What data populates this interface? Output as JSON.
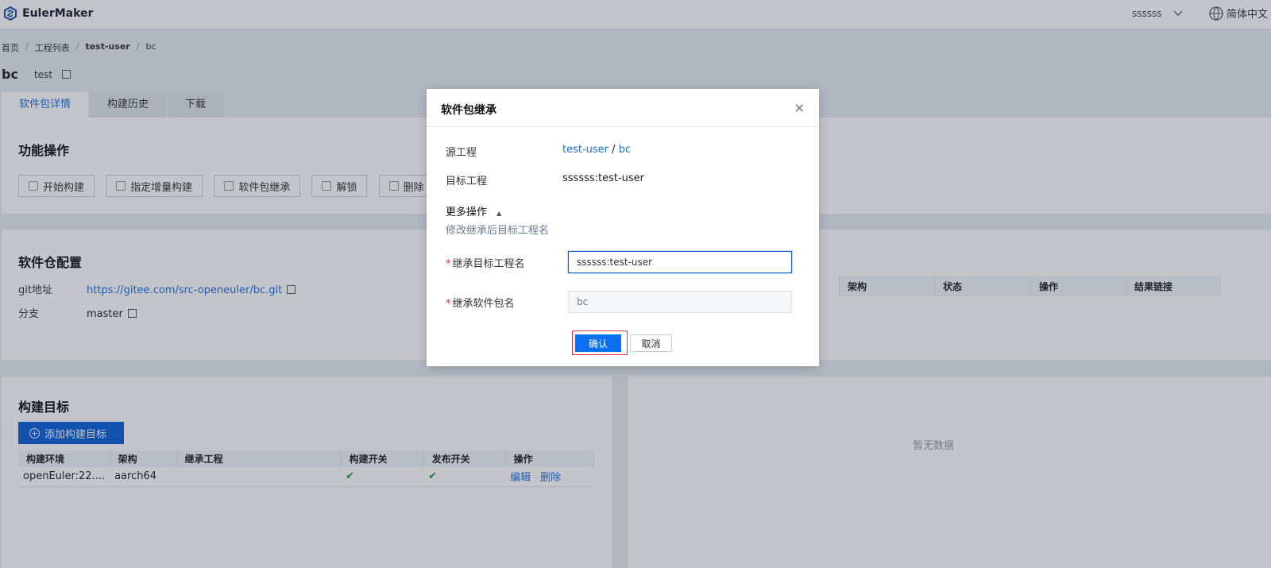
{
  "app": {
    "name": "EulerMaker",
    "user": "ssssss",
    "language": "简体中文"
  },
  "breadcrumb": [
    "首页",
    "工程列表",
    "test-user",
    "bc"
  ],
  "package": {
    "name": "bc",
    "description": "test"
  },
  "tabs": [
    "软件包详情",
    "构建历史",
    "下载"
  ],
  "ops": {
    "title": "功能操作",
    "buttons": [
      "开始构建",
      "指定增量构建",
      "软件包继承",
      "解锁",
      "删除"
    ]
  },
  "repo": {
    "title": "软件仓配置",
    "git_label": "git地址",
    "git_url": "https://gitee.com/src-openeuler/bc.git",
    "branch_label": "分支",
    "branch": "master"
  },
  "targets": {
    "title": "构建目标",
    "add_button": "添加构建目标",
    "columns": [
      "构建环境",
      "架构",
      "继承工程",
      "构建开关",
      "发布开关",
      "操作"
    ],
    "rows": [
      {
        "env": "openEuler:22....",
        "arch": "aarch64",
        "inherit": "",
        "build": "✔",
        "publish": "✔",
        "edit": "编辑",
        "delete": "删除"
      }
    ]
  },
  "history": {
    "columns": [
      "架构",
      "状态",
      "操作",
      "结果链接"
    ],
    "empty": "暂无数据"
  },
  "modal": {
    "title": "软件包继承",
    "close": "×",
    "source_label": "源工程",
    "source_project": "test-user",
    "source_sep": "/",
    "source_package": "bc",
    "target_label": "目标工程",
    "target_value": "ssssss:test-user",
    "more_label": "更多操作",
    "more_hint": "修改继承后目标工程名",
    "field1_label": "继承目标工程名",
    "field1_value": "ssssss:test-user",
    "field2_label": "继承软件包名",
    "field2_placeholder": "bc",
    "confirm": "确认",
    "cancel": "取消"
  }
}
